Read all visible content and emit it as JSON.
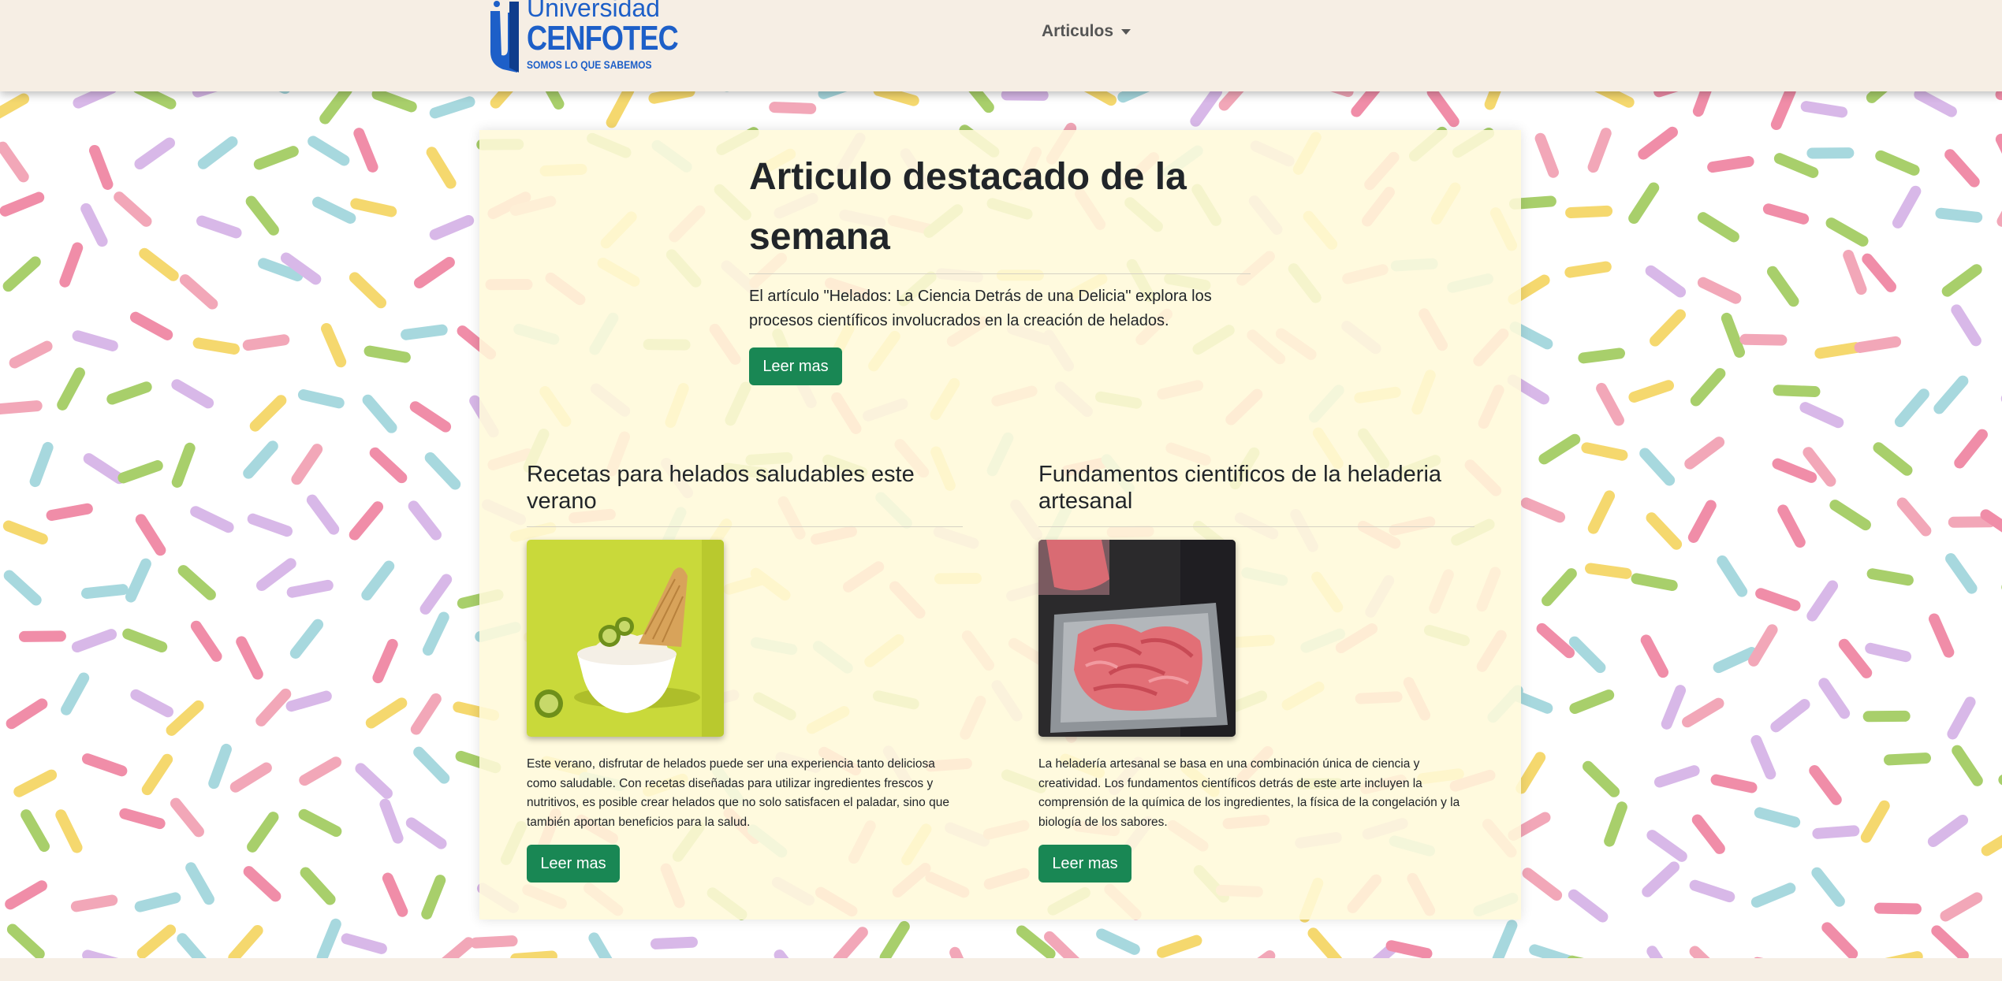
{
  "header": {
    "logo": {
      "line1": "Universidad",
      "line2": "CENFOTEC",
      "tagline": "SOMOS LO QUE SABEMOS"
    },
    "nav_menu_label": "Articulos"
  },
  "featured": {
    "title": "Articulo destacado de la semana",
    "text": "El artículo \"Helados: La Ciencia Detrás de una Delicia\" explora los procesos científicos involucrados en la creación de helados.",
    "button_label": "Leer mas"
  },
  "cards": [
    {
      "title": "Recetas para helados saludables este verano",
      "image": "ice-cream-bowl-with-kiwi-and-cone",
      "text": "Este verano, disfrutar de helados puede ser una experiencia tanto deliciosa como saludable. Con recetas diseñadas para utilizar ingredientes frescos y nutritivos, es posible crear helados que no solo satisfacen el paladar, sino que también aportan beneficios para la salud.",
      "button_label": "Leer mas"
    },
    {
      "title": "Fundamentos cientificos de la heladeria artesanal",
      "image": "pink-gelato-in-steel-tray",
      "text": "La heladería artesanal se basa en una combinación única de ciencia y creatividad. Los fundamentos científicos detrás de este arte incluyen la comprensión de la química de los ingredientes, la física de la congelación y la biología de los sabores.",
      "button_label": "Leer mas"
    }
  ],
  "colors": {
    "navbar": "#f6eee4",
    "panel": "#fff9da",
    "button": "#198754",
    "brand": "#1d5fc8",
    "sprinkles": [
      "#f2a7b8",
      "#f5d86e",
      "#a7d8de",
      "#a8cf6b",
      "#d8b8e8",
      "#f08da8"
    ]
  }
}
